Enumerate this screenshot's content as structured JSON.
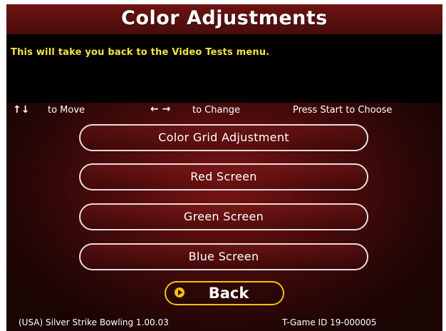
{
  "header": {
    "title": "Color Adjustments"
  },
  "description": {
    "text": "This will take you back to the Video Tests menu."
  },
  "hints": {
    "move_icon": "↑↓",
    "move_label": "to Move",
    "change_icon": "← →",
    "change_label": "to Change",
    "choose_label": "Press Start to Choose"
  },
  "menu": {
    "items": [
      {
        "label": "Color Grid Adjustment"
      },
      {
        "label": "Red Screen"
      },
      {
        "label": "Green Screen"
      },
      {
        "label": "Blue Screen"
      }
    ],
    "back_label": "Back",
    "selected": "Back"
  },
  "footer": {
    "game_info": "(USA) Silver Strike Bowling 1.00.03",
    "game_id": "T-Game ID 19-000005"
  },
  "colors": {
    "description_text": "#f2e24a",
    "selected_outline": "#f2c20a",
    "button_outline": "#e8dede",
    "background": "#4a0b0b"
  }
}
